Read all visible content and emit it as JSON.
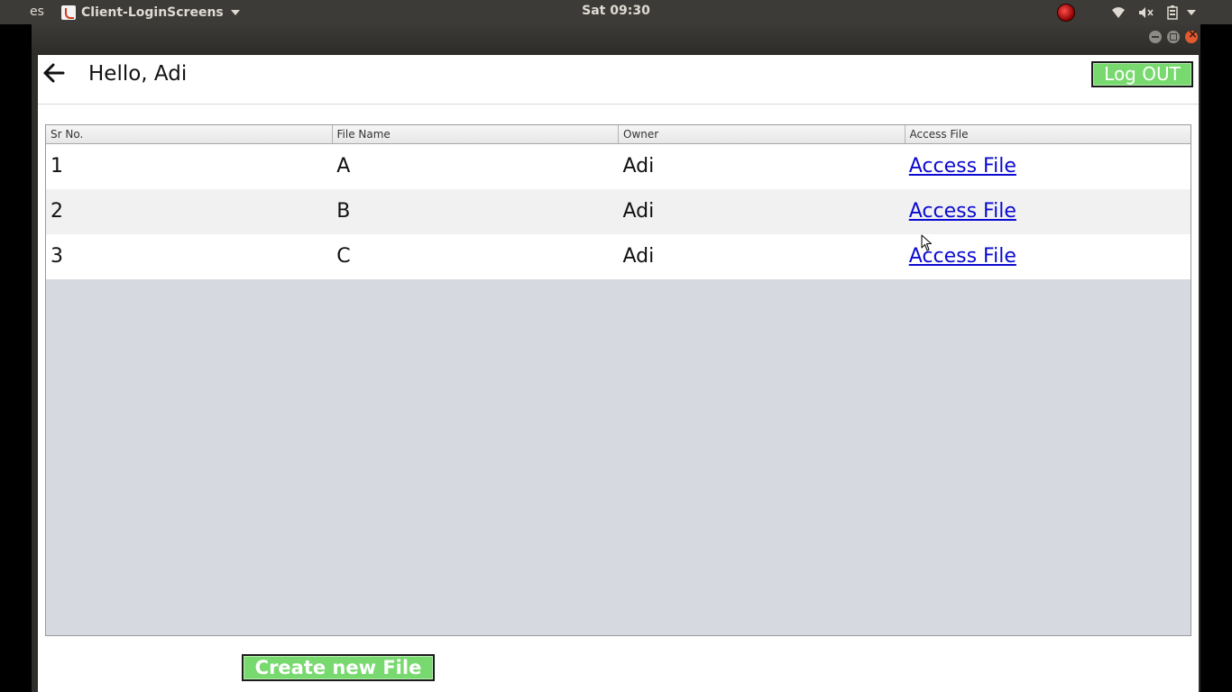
{
  "system_bar": {
    "activities_label": "es",
    "app_name": "Client-LoginScreens",
    "clock": "Sat 09:30"
  },
  "header": {
    "greeting": "Hello, Adi",
    "logout_label": "Log OUT"
  },
  "table": {
    "columns": [
      "Sr No.",
      "File Name",
      "Owner",
      "Access File"
    ],
    "rows": [
      {
        "sr": "1",
        "file": "A",
        "owner": "Adi",
        "action": "Access File"
      },
      {
        "sr": "2",
        "file": "B",
        "owner": "Adi",
        "action": "Access File"
      },
      {
        "sr": "3",
        "file": "C",
        "owner": "Adi",
        "action": "Access File"
      }
    ]
  },
  "footer": {
    "create_label": "Create new File"
  },
  "colors": {
    "button_green": "#77d96e",
    "link_blue": "#0b0bd0",
    "table_empty_bg": "#d6d9e0"
  }
}
